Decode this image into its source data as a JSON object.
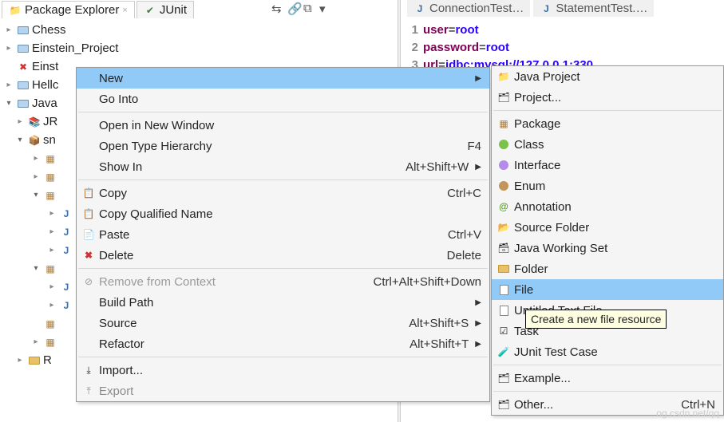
{
  "tabs": {
    "package_explorer": "Package Explorer",
    "junit": "JUnit"
  },
  "editor_tabs": {
    "connection_test": "ConnectionTest…",
    "statement_test": "StatementTest.…"
  },
  "tree": {
    "chess": "Chess",
    "einstein_project": "Einstein_Project",
    "einst_trunc": "Einst",
    "hello_trunc": "Hellc",
    "java_trunc": "Java",
    "jr_trunc": "JR",
    "sn_trunc": "sn",
    "r_trunc": "R"
  },
  "editor": {
    "l1_key": "user",
    "l1_val": "root",
    "l2_key": "password",
    "l2_val": "root",
    "l3_key": "url",
    "l3_val": "jdbc:mysql://127.0.0.1:330",
    "ln1": "1",
    "ln2": "2",
    "ln3": "3"
  },
  "menu": {
    "new": "New",
    "go_into": "Go Into",
    "open_new_window": "Open in New Window",
    "open_type_hierarchy": "Open Type Hierarchy",
    "open_type_hierarchy_acc": "F4",
    "show_in": "Show In",
    "show_in_acc": "Alt+Shift+W",
    "copy": "Copy",
    "copy_acc": "Ctrl+C",
    "copy_qualified": "Copy Qualified Name",
    "paste": "Paste",
    "paste_acc": "Ctrl+V",
    "delete": "Delete",
    "delete_acc": "Delete",
    "remove_context": "Remove from Context",
    "remove_context_acc": "Ctrl+Alt+Shift+Down",
    "build_path": "Build Path",
    "source": "Source",
    "source_acc": "Alt+Shift+S",
    "refactor": "Refactor",
    "refactor_acc": "Alt+Shift+T",
    "import": "Import...",
    "export": "Export"
  },
  "submenu": {
    "java_project": "Java Project",
    "project": "Project...",
    "package": "Package",
    "class": "Class",
    "interface": "Interface",
    "enum": "Enum",
    "annotation": "Annotation",
    "source_folder": "Source Folder",
    "java_working_set": "Java Working Set",
    "folder": "Folder",
    "file": "File",
    "untitled_text": "Untitled Text File",
    "task": "Task",
    "junit_test_case": "JUnit Test Case",
    "example": "Example...",
    "other": "Other...",
    "other_acc": "Ctrl+N"
  },
  "tooltip": "Create a new file resource",
  "watermark": "og.csdn.net/qq"
}
